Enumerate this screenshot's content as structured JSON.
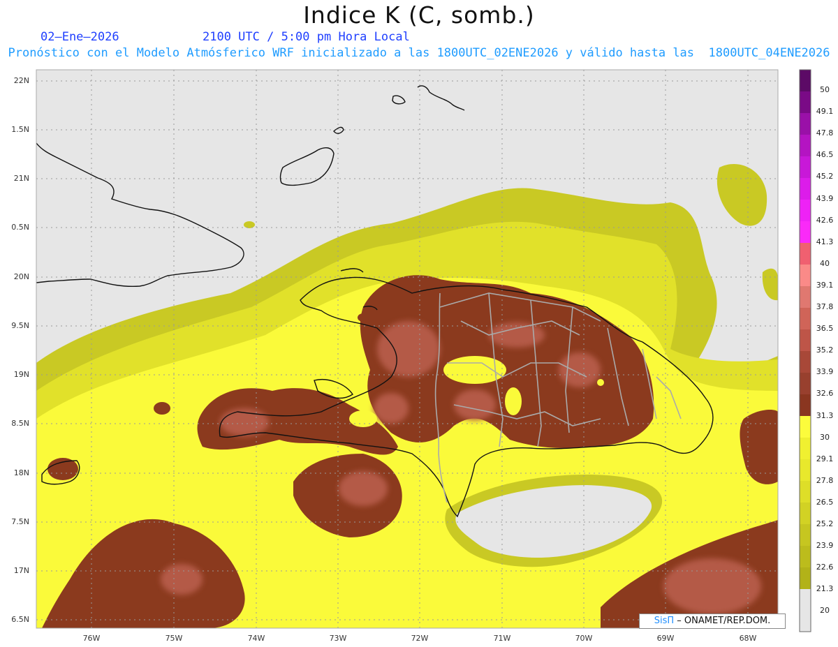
{
  "header": {
    "title": "Indice K (C, somb.)",
    "date": "02–Ene–2026",
    "time": "2100 UTC / 5:00 pm Hora Local",
    "forecast": "Pronóstico con el Modelo Atmósferico WRF inicializado a las 1800UTC_02ENE2026 y válido hasta las  1800UTC_04ENE2026"
  },
  "axes": {
    "lat_labels": [
      "22N",
      "1.5N",
      "21N",
      "0.5N",
      "20N",
      "9.5N",
      "19N",
      "8.5N",
      "18N",
      "7.5N",
      "17N",
      "6.5N"
    ],
    "lon_labels": [
      "76W",
      "75W",
      "74W",
      "73W",
      "72W",
      "71W",
      "70W",
      "69W",
      "68W"
    ]
  },
  "legend": {
    "labels": [
      "50",
      "49.1",
      "47.8",
      "46.5",
      "45.2",
      "43.9",
      "42.6",
      "41.3",
      "40",
      "39.1",
      "37.8",
      "36.5",
      "35.2",
      "33.9",
      "32.6",
      "31.3",
      "30",
      "29.1",
      "27.8",
      "26.5",
      "25.2",
      "23.9",
      "22.6",
      "21.3",
      "20"
    ],
    "colors": [
      "#5c0a66",
      "#7a0a86",
      "#9a10a8",
      "#b414c2",
      "#c818d8",
      "#dc1cea",
      "#ee22f6",
      "#fa2af8",
      "#f06070",
      "#fa8a88",
      "#e07870",
      "#d06458",
      "#be5548",
      "#a84838",
      "#98402e",
      "#8a3620",
      "#fcfc3c",
      "#f0f030",
      "#e8e82c",
      "#dede28",
      "#d2d224",
      "#c6c620",
      "#bcbc1c",
      "#b2b218",
      "#e6e6e6"
    ]
  },
  "credit": {
    "brand": "SisΠ",
    "text": "– ONAMET/REP.DOM."
  }
}
